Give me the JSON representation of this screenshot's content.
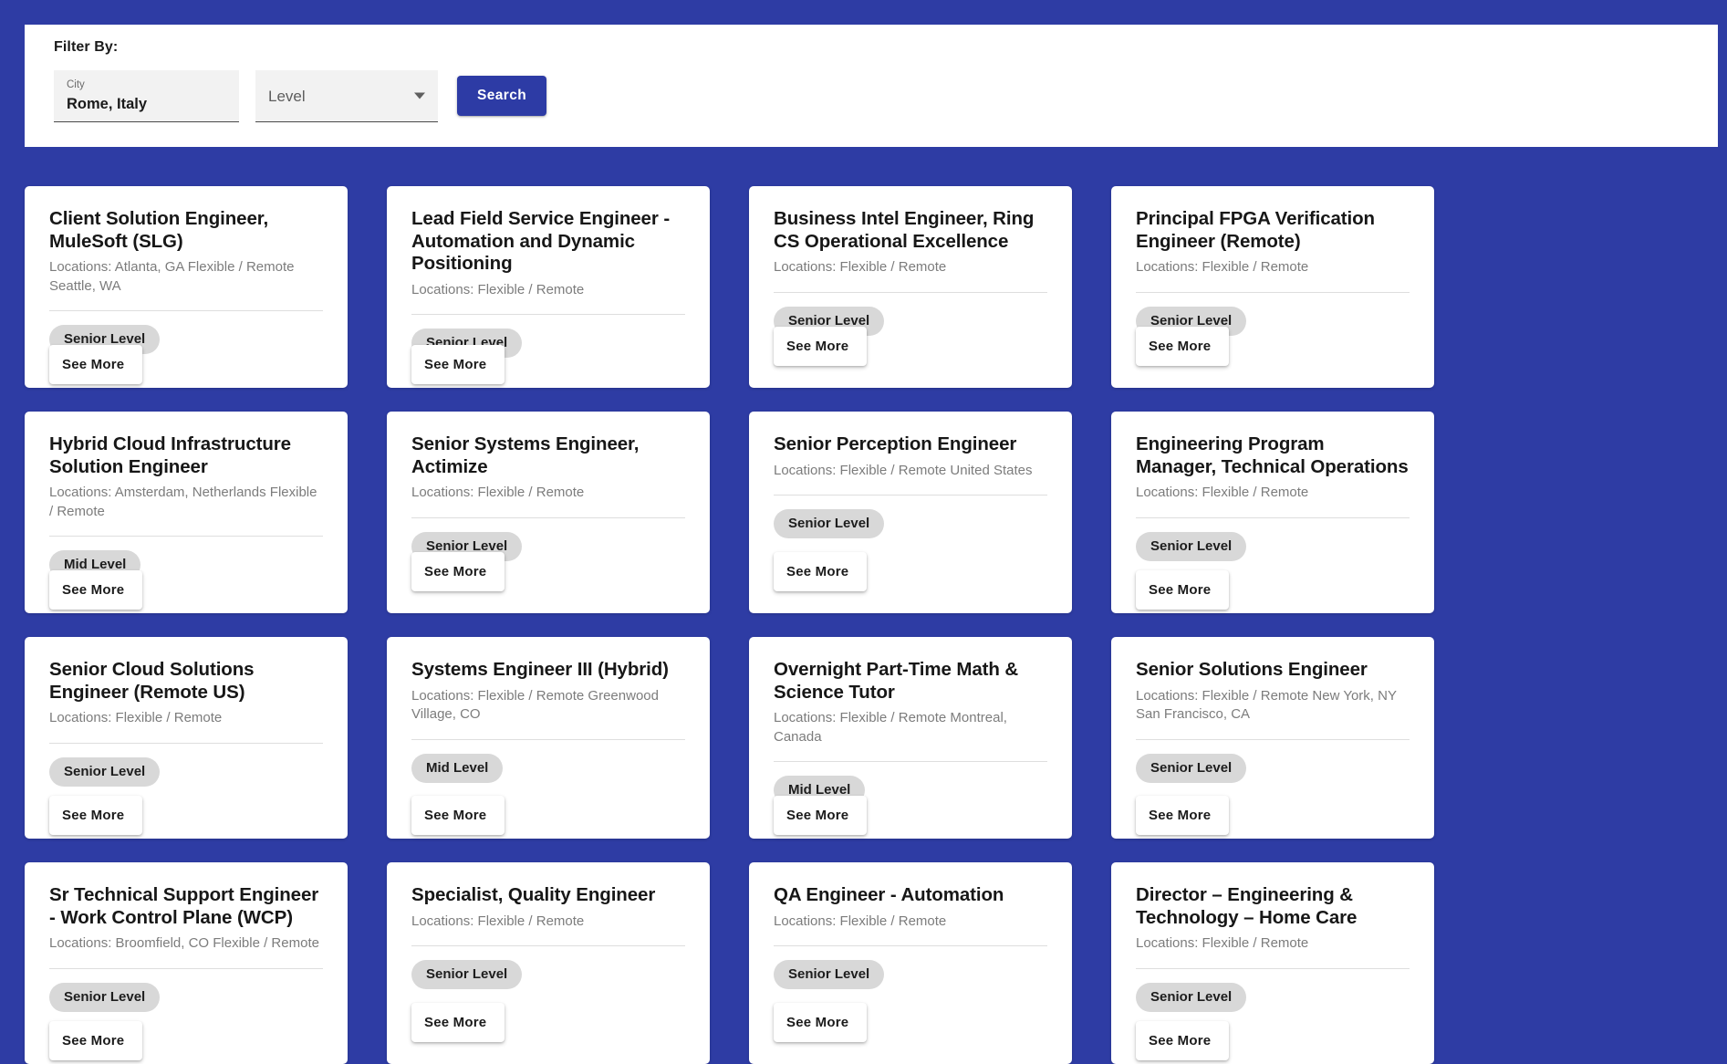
{
  "filter": {
    "title": "Filter By:",
    "city": {
      "label": "City",
      "value": "Rome, Italy",
      "placeholder": "City"
    },
    "level": {
      "label": "Level",
      "placeholder": "Level",
      "selected": "Level"
    },
    "search_label": "Search"
  },
  "labels": {
    "see_more": "See More",
    "locations_prefix": "Locations: "
  },
  "colors": {
    "background": "#2e3ca4",
    "accent": "#2d3ba5",
    "card": "#ffffff",
    "chip": "#d8d8d8",
    "muted_text": "#7c7c7c"
  },
  "jobs": [
    {
      "title": "Client Solution Engineer, MuleSoft (SLG)",
      "locations": "Locations: Atlanta, GA Flexible / Remote Seattle, WA",
      "level": "Senior Level",
      "see_more": "See More",
      "button_pos": "low"
    },
    {
      "title": "Lead Field Service Engineer - Automation and Dynamic Positioning",
      "locations": "Locations: Flexible / Remote",
      "level": "Senior Level",
      "see_more": "See More",
      "button_pos": "low"
    },
    {
      "title": "Business Intel Engineer, Ring CS Operational Excellence",
      "locations": "Locations: Flexible / Remote",
      "level": "Senior Level",
      "see_more": "See More",
      "button_pos": "high"
    },
    {
      "title": "Principal FPGA Verification Engineer (Remote)",
      "locations": "Locations: Flexible / Remote",
      "level": "Senior Level",
      "see_more": "See More",
      "button_pos": "high"
    },
    {
      "title": "Hybrid Cloud Infrastructure Solution Engineer",
      "locations": "Locations: Amsterdam, Netherlands Flexible / Remote",
      "level": "Mid Level",
      "see_more": "See More",
      "button_pos": "low"
    },
    {
      "title": "Senior Systems Engineer, Actimize",
      "locations": "Locations: Flexible / Remote",
      "level": "Senior Level",
      "see_more": "See More",
      "button_pos": "high"
    },
    {
      "title": "Senior Perception Engineer",
      "locations": "Locations: Flexible / Remote United States",
      "level": "Senior Level",
      "see_more": "See More",
      "button_pos": "high"
    },
    {
      "title": "Engineering Program Manager, Technical Operations",
      "locations": "Locations: Flexible / Remote",
      "level": "Senior Level",
      "see_more": "See More",
      "button_pos": "low"
    },
    {
      "title": "Senior Cloud Solutions Engineer (Remote US)",
      "locations": "Locations: Flexible / Remote",
      "level": "Senior Level",
      "see_more": "See More",
      "button_pos": "low"
    },
    {
      "title": "Systems Engineer III (Hybrid)",
      "locations": "Locations: Flexible / Remote Greenwood Village, CO",
      "level": "Mid Level",
      "see_more": "See More",
      "button_pos": "low"
    },
    {
      "title": "Overnight Part-Time Math & Science Tutor",
      "locations": "Locations: Flexible / Remote Montreal, Canada",
      "level": "Mid Level",
      "see_more": "See More",
      "button_pos": "low"
    },
    {
      "title": "Senior Solutions Engineer",
      "locations": "Locations: Flexible / Remote New York, NY San Francisco, CA",
      "level": "Senior Level",
      "see_more": "See More",
      "button_pos": "low"
    },
    {
      "title": "Sr Technical Support Engineer - Work Control Plane (WCP)",
      "locations": "Locations: Broomfield, CO Flexible / Remote",
      "level": "Senior Level",
      "see_more": "See More",
      "button_pos": "low"
    },
    {
      "title": "Specialist, Quality Engineer",
      "locations": "Locations: Flexible / Remote",
      "level": "Senior Level",
      "see_more": "See More",
      "button_pos": "high"
    },
    {
      "title": "QA Engineer - Automation",
      "locations": "Locations: Flexible / Remote",
      "level": "Senior Level",
      "see_more": "See More",
      "button_pos": "high"
    },
    {
      "title": "Director – Engineering & Technology – Home Care",
      "locations": "Locations: Flexible / Remote",
      "level": "Senior Level",
      "see_more": "See More",
      "button_pos": "low"
    }
  ]
}
